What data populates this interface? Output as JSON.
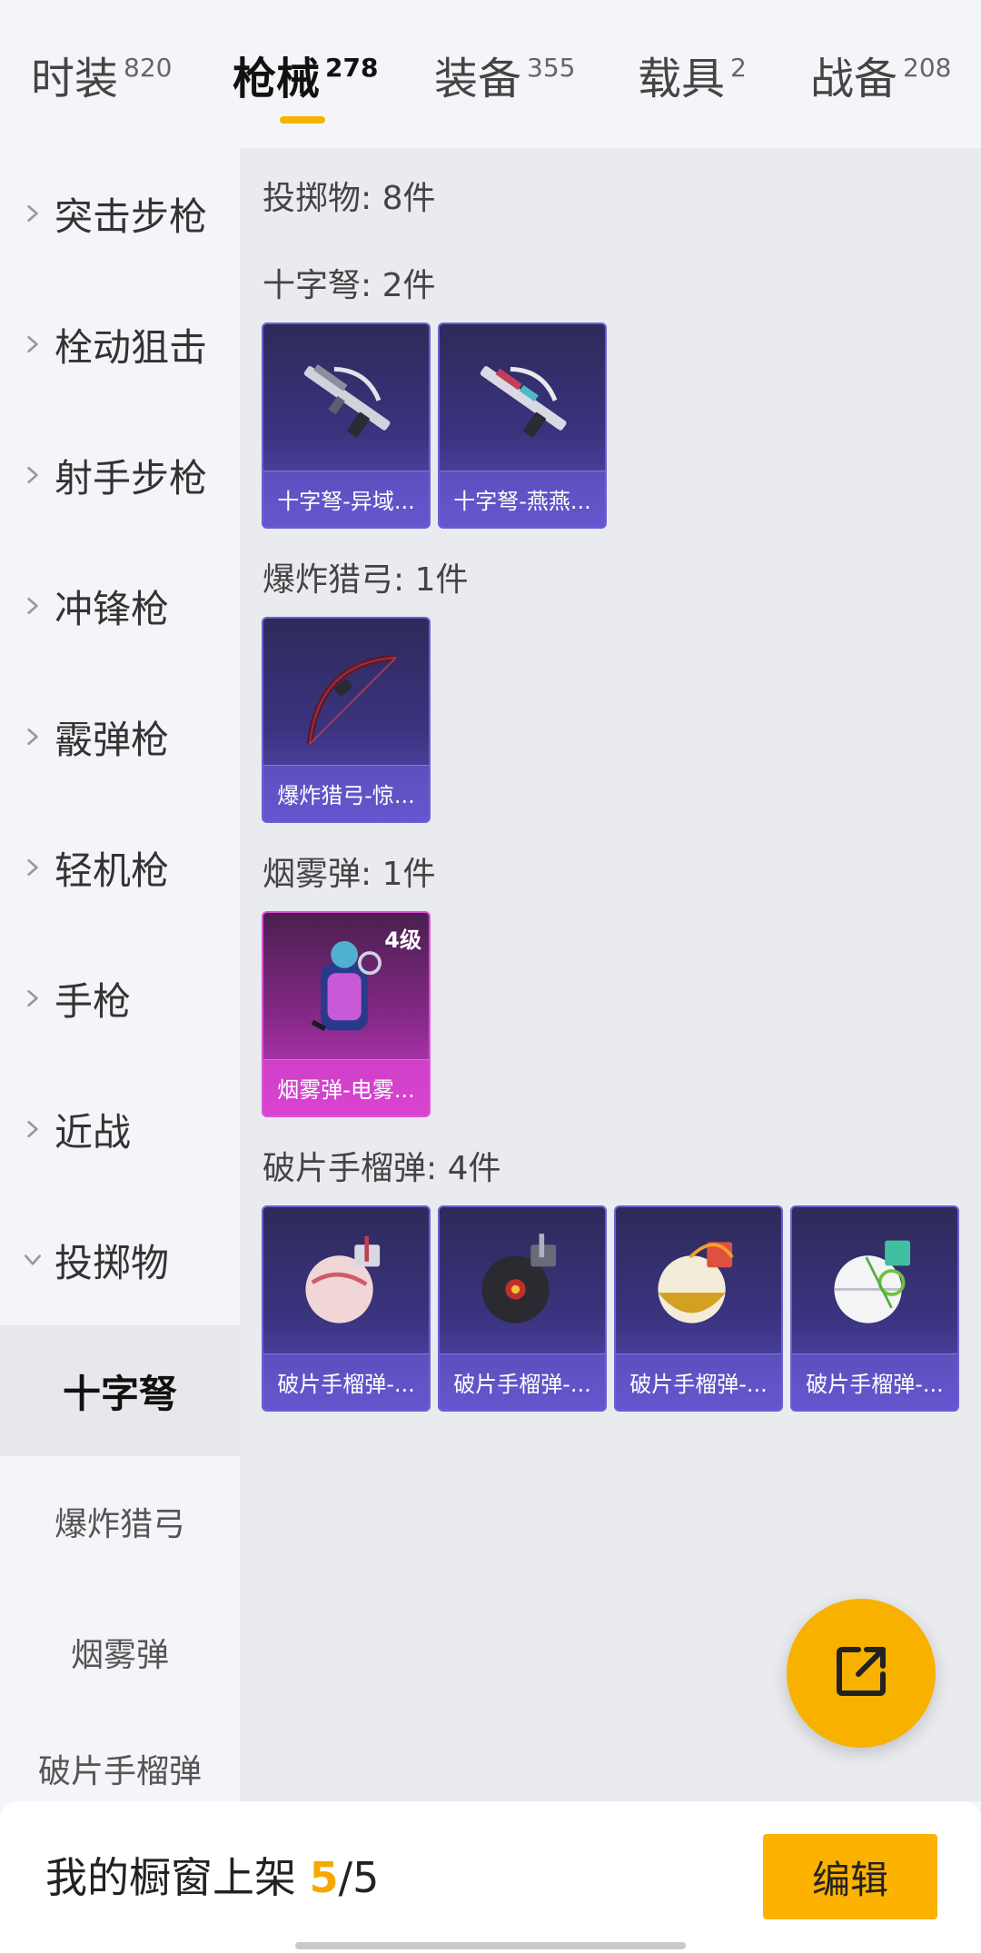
{
  "tabs": [
    {
      "label": "时装",
      "count": "820"
    },
    {
      "label": "枪械",
      "count": "278"
    },
    {
      "label": "装备",
      "count": "355"
    },
    {
      "label": "载具",
      "count": "2"
    },
    {
      "label": "战备",
      "count": "208"
    }
  ],
  "active_tab": "枪械",
  "sidebar": {
    "categories": [
      {
        "label": "突击步枪",
        "expanded": false
      },
      {
        "label": "栓动狙击",
        "expanded": false
      },
      {
        "label": "射手步枪",
        "expanded": false
      },
      {
        "label": "冲锋枪",
        "expanded": false
      },
      {
        "label": "霰弹枪",
        "expanded": false
      },
      {
        "label": "轻机枪",
        "expanded": false
      },
      {
        "label": "手枪",
        "expanded": false
      },
      {
        "label": "近战",
        "expanded": false
      },
      {
        "label": "投掷物",
        "expanded": true
      }
    ],
    "subcategories": [
      {
        "label": "十字弩",
        "active": true
      },
      {
        "label": "爆炸猎弓",
        "active": false
      },
      {
        "label": "烟雾弹",
        "active": false
      },
      {
        "label": "破片手榴弹",
        "active": false
      }
    ]
  },
  "main": {
    "header": "投掷物: 8件",
    "sections": [
      {
        "title": "十字弩: 2件",
        "items": [
          {
            "name": "十字弩-异域..."
          },
          {
            "name": "十字弩-燕燕..."
          }
        ]
      },
      {
        "title": "爆炸猎弓: 1件",
        "items": [
          {
            "name": "爆炸猎弓-惊..."
          }
        ]
      },
      {
        "title": "烟雾弹: 1件",
        "items": [
          {
            "name": "烟雾弹-电雾...",
            "badge": "4级"
          }
        ]
      },
      {
        "title": "破片手榴弹: 4件",
        "items": [
          {
            "name": "破片手榴弹-..."
          },
          {
            "name": "破片手榴弹-..."
          },
          {
            "name": "破片手榴弹-..."
          },
          {
            "name": "破片手榴弹-..."
          }
        ]
      }
    ]
  },
  "bottom_bar": {
    "shelf_label": "我的橱窗上架",
    "shelf_current": "5",
    "shelf_separator": "/",
    "shelf_total": "5",
    "edit_label": "编辑"
  },
  "colors": {
    "accent": "#f5b400",
    "card_purple": "#3a3480",
    "card_pink": "#d23fcf"
  },
  "icons": {
    "sidebar_collapsed": "chevron-right-icon",
    "sidebar_expanded": "chevron-down-icon",
    "fab": "share-external-icon"
  }
}
